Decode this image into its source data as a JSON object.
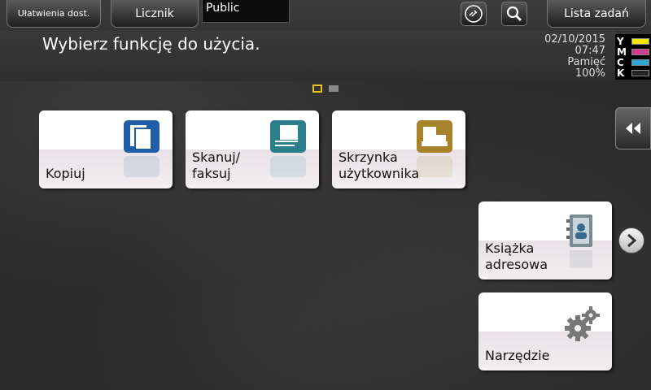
{
  "topbar": {
    "accessibility_label": "Ułatwienia dost.",
    "counter_label": "Licznik",
    "user": "Public",
    "job_list_label": "Lista zadań",
    "icons": [
      "link-icon",
      "search-icon"
    ]
  },
  "message": "Wybierz funkcję do użycia.",
  "status": {
    "date": "02/10/2015",
    "time": "07:47",
    "memory_label": "Pamięć",
    "memory_value": "100%"
  },
  "toner": [
    {
      "letter": "Y",
      "color": "#f3e600"
    },
    {
      "letter": "M",
      "color": "#d13a8f"
    },
    {
      "letter": "C",
      "color": "#2fa5d6"
    },
    {
      "letter": "K",
      "color": "#222222"
    }
  ],
  "tiles": [
    {
      "id": "copy",
      "label": "Kopiuj",
      "icon": "copy-icon",
      "color": "#1f5fa8"
    },
    {
      "id": "scan",
      "label_line1": "Skanuj/",
      "label_line2": "faksuj",
      "icon": "scan-fax-icon",
      "color": "#2a7f88"
    },
    {
      "id": "box",
      "label_line1": "Skrzynka",
      "label_line2": "użytkownika",
      "icon": "user-box-icon",
      "color": "#a8822a"
    },
    {
      "id": "address",
      "label_line1": "Książka",
      "label_line2": "adresowa",
      "icon": "address-book-icon",
      "color": "#7a8a92"
    },
    {
      "id": "utility",
      "label": "Narzędzie",
      "icon": "gear-icon",
      "color": "#777777"
    }
  ],
  "pages": {
    "current": 1,
    "total": 2
  },
  "colors": {
    "page_active": "#e8c020",
    "page_inactive": "#888888"
  }
}
